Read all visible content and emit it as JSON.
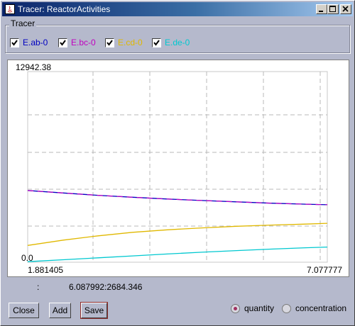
{
  "window": {
    "title": "Tracer: ReactorActivities",
    "controls": [
      "minimize",
      "maximize",
      "close"
    ]
  },
  "tracer_group": {
    "legend": "Tracer",
    "items": [
      {
        "label": "E.ab-0",
        "checked": true,
        "color": "#0000c0"
      },
      {
        "label": "E.bc-0",
        "checked": true,
        "color": "#c000c0"
      },
      {
        "label": "E.cd-0",
        "checked": true,
        "color": "#e0b800"
      },
      {
        "label": "E.de-0",
        "checked": true,
        "color": "#00c8d0"
      }
    ]
  },
  "plot": {
    "y_max_label": "12942.38",
    "y_min_label": "0.0",
    "x_min_label": "1.881405",
    "x_max_label": "7.077777"
  },
  "chart_data": {
    "type": "line",
    "grid": true,
    "xlim": [
      1.881405,
      7.077777
    ],
    "ylim": [
      0,
      12942.38
    ],
    "x": [
      1.881405,
      2.5,
      3.1,
      3.7,
      4.3,
      4.9,
      5.5,
      6.1,
      6.7,
      7.077777
    ],
    "series": [
      {
        "name": "E.ab-0",
        "color": "#0000c0",
        "values": [
          4870,
          4700,
          4540,
          4410,
          4290,
          4190,
          4100,
          4010,
          3940,
          3900
        ]
      },
      {
        "name": "E.bc-0",
        "color": "#c000c0",
        "values": [
          4870,
          4700,
          4540,
          4410,
          4290,
          4190,
          4100,
          4010,
          3940,
          3900
        ]
      },
      {
        "name": "E.cd-0",
        "color": "#e0b800",
        "values": [
          1140,
          1500,
          1790,
          2030,
          2200,
          2330,
          2440,
          2520,
          2590,
          2640
        ]
      },
      {
        "name": "E.de-0",
        "color": "#00c8d0",
        "values": [
          40,
          170,
          300,
          430,
          560,
          680,
          790,
          890,
          980,
          1030
        ]
      }
    ]
  },
  "readout": {
    "separator": ":",
    "value": "6.087992:2684.346"
  },
  "buttons": {
    "close": "Close",
    "add": "Add",
    "save": "Save"
  },
  "mode": {
    "options": [
      "quantity",
      "concentration"
    ],
    "selected": "quantity"
  }
}
